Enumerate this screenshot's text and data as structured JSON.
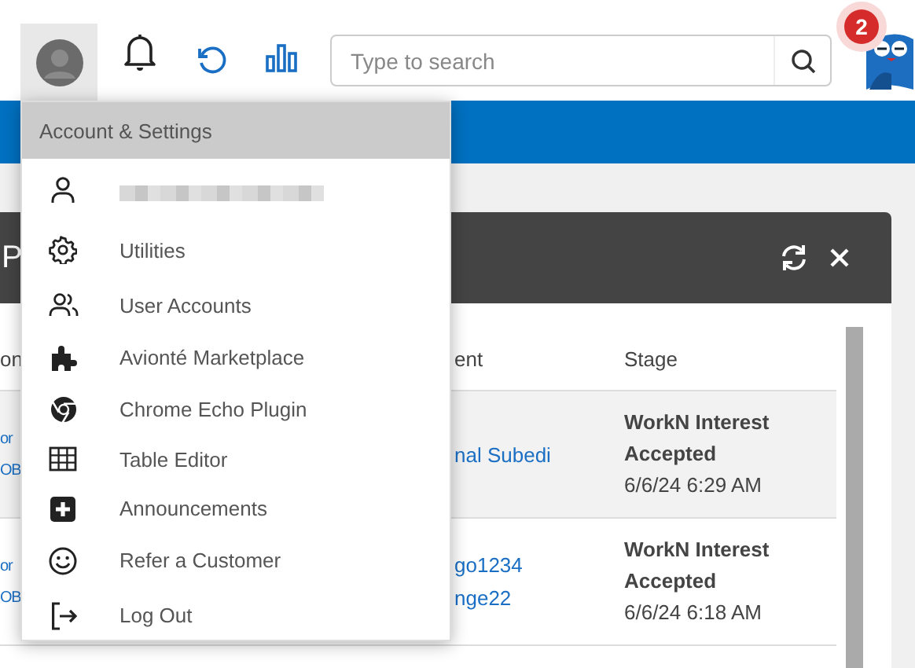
{
  "toolbar": {
    "account_button": {
      "selected": true
    },
    "search": {
      "placeholder": "Type to search"
    },
    "notification_badge": "2"
  },
  "panel": {
    "title": "P",
    "columns": [
      "on",
      "ent",
      "Stage"
    ],
    "rows": [
      {
        "highlighted": true,
        "column_1": [
          "or",
          "OB"
        ],
        "column_2": [
          "nal Subedi"
        ],
        "stage": "WorkN Interest Accepted",
        "time": "6/6/24 6:29 AM"
      },
      {
        "highlighted": false,
        "column_1": [
          "or",
          "OB"
        ],
        "column_2": [
          "go1234",
          "nge22"
        ],
        "stage": "WorkN Interest Accepted",
        "time": "6/6/24 6:18 AM"
      }
    ]
  },
  "menu": {
    "title": "Account & Settings",
    "items": [
      {
        "kind": "redacted"
      },
      {
        "kind": "link",
        "label": "Utilities"
      },
      {
        "kind": "link",
        "label": "User Accounts"
      },
      {
        "kind": "link",
        "label": "Avionté Marketplace"
      },
      {
        "kind": "link",
        "label": "Chrome Echo Plugin"
      },
      {
        "kind": "link",
        "label": "Table Editor"
      },
      {
        "kind": "link",
        "label": "Announcements"
      },
      {
        "kind": "link",
        "label": "Refer a Customer"
      },
      {
        "kind": "link",
        "label": "Log Out"
      }
    ]
  }
}
